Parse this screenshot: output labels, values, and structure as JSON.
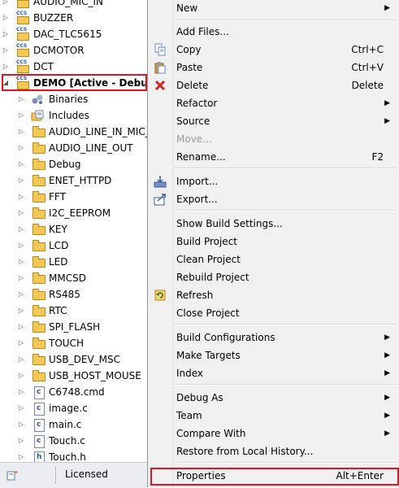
{
  "tree": {
    "items": [
      {
        "label": "AUDIO_MIC_IN",
        "kind": "project"
      },
      {
        "label": "BUZZER",
        "kind": "project"
      },
      {
        "label": "DAC_TLC5615",
        "kind": "project"
      },
      {
        "label": "DCMOTOR",
        "kind": "project"
      },
      {
        "label": "DCT",
        "kind": "project"
      },
      {
        "label": "DEMO  [Active - Debug]",
        "kind": "active-project"
      },
      {
        "label": "Binaries",
        "kind": "binaries"
      },
      {
        "label": "Includes",
        "kind": "includes"
      },
      {
        "label": "AUDIO_LINE_IN_MIC_",
        "kind": "folder"
      },
      {
        "label": "AUDIO_LINE_OUT",
        "kind": "folder"
      },
      {
        "label": "Debug",
        "kind": "folder"
      },
      {
        "label": "ENET_HTTPD",
        "kind": "folder"
      },
      {
        "label": "FFT",
        "kind": "folder"
      },
      {
        "label": "I2C_EEPROM",
        "kind": "folder"
      },
      {
        "label": "KEY",
        "kind": "folder"
      },
      {
        "label": "LCD",
        "kind": "folder"
      },
      {
        "label": "LED",
        "kind": "folder"
      },
      {
        "label": "MMCSD",
        "kind": "folder"
      },
      {
        "label": "RS485",
        "kind": "folder"
      },
      {
        "label": "RTC",
        "kind": "folder"
      },
      {
        "label": "SPI_FLASH",
        "kind": "folder"
      },
      {
        "label": "TOUCH",
        "kind": "folder"
      },
      {
        "label": "USB_DEV_MSC",
        "kind": "folder"
      },
      {
        "label": "USB_HOST_MOUSE",
        "kind": "folder"
      },
      {
        "label": "C6748.cmd",
        "kind": "file"
      },
      {
        "label": "image.c",
        "kind": "file"
      },
      {
        "label": "main.c",
        "kind": "file"
      },
      {
        "label": "Touch.c",
        "kind": "file"
      },
      {
        "label": "Touch.h",
        "kind": "file"
      }
    ]
  },
  "status": {
    "licensed": "Licensed"
  },
  "menu": {
    "new": "New",
    "add_files": "Add Files...",
    "copy": "Copy",
    "copy_sc": "Ctrl+C",
    "paste": "Paste",
    "paste_sc": "Ctrl+V",
    "delete": "Delete",
    "delete_sc": "Delete",
    "refactor": "Refactor",
    "source": "Source",
    "move": "Move...",
    "rename": "Rename...",
    "rename_sc": "F2",
    "import": "Import...",
    "export": "Export...",
    "show_build": "Show Build Settings...",
    "build_project": "Build Project",
    "clean_project": "Clean Project",
    "rebuild_project": "Rebuild Project",
    "refresh": "Refresh",
    "close_project": "Close Project",
    "build_configs": "Build Configurations",
    "make_targets": "Make Targets",
    "index": "Index",
    "debug_as": "Debug As",
    "team": "Team",
    "compare_with": "Compare With",
    "restore_history": "Restore from Local History...",
    "properties": "Properties",
    "properties_sc": "Alt+Enter"
  },
  "colors": {
    "highlight": "#e0141e",
    "menu_bg": "#f0f0f0"
  }
}
